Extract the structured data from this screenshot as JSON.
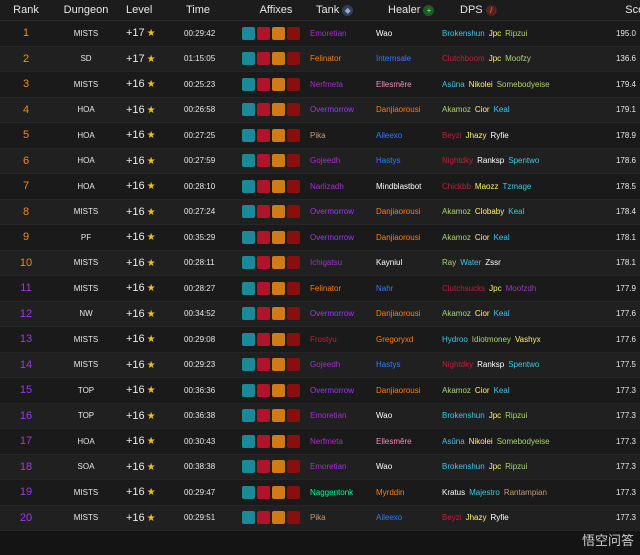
{
  "colors": {
    "orange": "#f08a24",
    "purple": "#a335ee",
    "blue": "#3f74d8",
    "white": "#e8e8e8",
    "dh": "#a330c9",
    "dk": "#c41e3a",
    "druid": "#ff7c0a",
    "hunter": "#aad372",
    "mage": "#3fc7eb",
    "monk": "#00ff98",
    "paladin": "#f48cba",
    "priest": "#ffffff",
    "rogue": "#fff468",
    "shaman": "#2f7dff",
    "warlock": "#8788ee",
    "warrior": "#c69b6d"
  },
  "headers": {
    "rank": "Rank",
    "dungeon": "Dungeon",
    "level": "Level",
    "time": "Time",
    "affixes": "Affixes",
    "tank": "Tank",
    "healer": "Healer",
    "dps": "DPS",
    "score": "Score"
  },
  "icons": {
    "star": "star-icon",
    "tank": "shield-icon",
    "healer": "plus-icon",
    "dps": "sword-icon",
    "faction": "faction-icon",
    "affixes": [
      "tyrannical-icon",
      "bursting-icon",
      "volcanic-icon",
      "reaping-icon"
    ]
  },
  "watermark": "悟空问答",
  "rows": [
    {
      "rank": "1",
      "rank_color": "#f08a24",
      "dungeon": "MISTS",
      "level": "+17",
      "time": "00:29:42",
      "tank": {
        "name": "Emoretian",
        "color": "#a330c9"
      },
      "healer": {
        "name": "Wao",
        "color": "#ffffff"
      },
      "dps": [
        {
          "name": "Brokenshun",
          "color": "#3fc7eb"
        },
        {
          "name": "Jpc",
          "color": "#fff468"
        },
        {
          "name": "Ripzui",
          "color": "#aad372"
        }
      ],
      "score": "195.0",
      "faction": "horde"
    },
    {
      "rank": "2",
      "rank_color": "#f08a24",
      "dungeon": "SD",
      "level": "+17",
      "time": "01:15:05",
      "tank": {
        "name": "Felinator",
        "color": "#ff7c0a"
      },
      "healer": {
        "name": "Internsale",
        "color": "#2f7dff"
      },
      "dps": [
        {
          "name": "Clutchboom",
          "color": "#c41e3a"
        },
        {
          "name": "Jpc",
          "color": "#fff468"
        },
        {
          "name": "Moofzy",
          "color": "#aad372"
        }
      ],
      "score": "136.6",
      "faction": "horde"
    },
    {
      "rank": "3",
      "rank_color": "#f08a24",
      "dungeon": "MISTS",
      "level": "+16",
      "time": "00:25:23",
      "tank": {
        "name": "Nerfmeta",
        "color": "#a330c9"
      },
      "healer": {
        "name": "Ellesmêre",
        "color": "#f48cba"
      },
      "dps": [
        {
          "name": "Asûna",
          "color": "#3fc7eb"
        },
        {
          "name": "Nikolei",
          "color": "#fff468"
        },
        {
          "name": "Somebodyeise",
          "color": "#aad372"
        }
      ],
      "score": "179.4",
      "faction": "horde"
    },
    {
      "rank": "4",
      "rank_color": "#f08a24",
      "dungeon": "HOA",
      "level": "+16",
      "time": "00:26:58",
      "tank": {
        "name": "Overmorrow",
        "color": "#a335ee"
      },
      "healer": {
        "name": "Danjiaorousi",
        "color": "#ff7c0a"
      },
      "dps": [
        {
          "name": "Akamoz",
          "color": "#aad372"
        },
        {
          "name": "Cior",
          "color": "#fff468"
        },
        {
          "name": "Keal",
          "color": "#3fc7eb"
        }
      ],
      "score": "179.1",
      "faction": "horde"
    },
    {
      "rank": "5",
      "rank_color": "#f08a24",
      "dungeon": "HOA",
      "level": "+16",
      "time": "00:27:25",
      "tank": {
        "name": "Pika",
        "color": "#c69b6d"
      },
      "healer": {
        "name": "Aileexo",
        "color": "#2f7dff"
      },
      "dps": [
        {
          "name": "Beyzi",
          "color": "#c41e3a"
        },
        {
          "name": "Jhazy",
          "color": "#fff468"
        },
        {
          "name": "Ryfie",
          "color": "#ffffff"
        }
      ],
      "score": "178.9",
      "faction": "horde"
    },
    {
      "rank": "6",
      "rank_color": "#f08a24",
      "dungeon": "HOA",
      "level": "+16",
      "time": "00:27:59",
      "tank": {
        "name": "Gojeedh",
        "color": "#a330c9"
      },
      "healer": {
        "name": "Hastys",
        "color": "#2f7dff"
      },
      "dps": [
        {
          "name": "Nightdky",
          "color": "#c41e3a"
        },
        {
          "name": "Ranksp",
          "color": "#ffffff"
        },
        {
          "name": "Spentwo",
          "color": "#3fc7eb"
        }
      ],
      "score": "178.6",
      "faction": "horde"
    },
    {
      "rank": "7",
      "rank_color": "#f08a24",
      "dungeon": "HOA",
      "level": "+16",
      "time": "00:28:10",
      "tank": {
        "name": "Narlizadh",
        "color": "#a330c9"
      },
      "healer": {
        "name": "Mindblastbot",
        "color": "#ffffff"
      },
      "dps": [
        {
          "name": "Chickbb",
          "color": "#c41e3a"
        },
        {
          "name": "Maozz",
          "color": "#fff468"
        },
        {
          "name": "Tzmage",
          "color": "#3fc7eb"
        }
      ],
      "score": "178.5",
      "faction": "horde"
    },
    {
      "rank": "8",
      "rank_color": "#f08a24",
      "dungeon": "MISTS",
      "level": "+16",
      "time": "00:27:24",
      "tank": {
        "name": "Overmorrow",
        "color": "#a335ee"
      },
      "healer": {
        "name": "Danjiaorousi",
        "color": "#ff7c0a"
      },
      "dps": [
        {
          "name": "Akamoz",
          "color": "#aad372"
        },
        {
          "name": "Clobaby",
          "color": "#fff468"
        },
        {
          "name": "Keal",
          "color": "#3fc7eb"
        }
      ],
      "score": "178.4",
      "faction": "horde"
    },
    {
      "rank": "9",
      "rank_color": "#f08a24",
      "dungeon": "PF",
      "level": "+16",
      "time": "00:35:29",
      "tank": {
        "name": "Overmorrow",
        "color": "#a335ee"
      },
      "healer": {
        "name": "Danjiaorousi",
        "color": "#ff7c0a"
      },
      "dps": [
        {
          "name": "Akamoz",
          "color": "#aad372"
        },
        {
          "name": "Cior",
          "color": "#fff468"
        },
        {
          "name": "Keal",
          "color": "#3fc7eb"
        }
      ],
      "score": "178.1",
      "faction": "horde"
    },
    {
      "rank": "10",
      "rank_color": "#f08a24",
      "dungeon": "MISTS",
      "level": "+16",
      "time": "00:28:11",
      "tank": {
        "name": "Ichigatsu",
        "color": "#a330c9"
      },
      "healer": {
        "name": "Kayniul",
        "color": "#ffffff"
      },
      "dps": [
        {
          "name": "Ray",
          "color": "#aad372"
        },
        {
          "name": "Water",
          "color": "#3fc7eb"
        },
        {
          "name": "Zssr",
          "color": "#ffffff"
        }
      ],
      "score": "178.1",
      "faction": "horde"
    },
    {
      "rank": "11",
      "rank_color": "#a335ee",
      "dungeon": "MISTS",
      "level": "+16",
      "time": "00:28:27",
      "tank": {
        "name": "Felinator",
        "color": "#ff7c0a"
      },
      "healer": {
        "name": "Nahr",
        "color": "#2f7dff"
      },
      "dps": [
        {
          "name": "Clutchsucks",
          "color": "#c41e3a"
        },
        {
          "name": "Jpc",
          "color": "#fff468"
        },
        {
          "name": "Moofzdh",
          "color": "#a330c9"
        }
      ],
      "score": "177.9",
      "faction": "horde"
    },
    {
      "rank": "12",
      "rank_color": "#a335ee",
      "dungeon": "NW",
      "level": "+16",
      "time": "00:34:52",
      "tank": {
        "name": "Overmorrow",
        "color": "#a335ee"
      },
      "healer": {
        "name": "Danjiaorousi",
        "color": "#ff7c0a"
      },
      "dps": [
        {
          "name": "Akamoz",
          "color": "#aad372"
        },
        {
          "name": "Cior",
          "color": "#fff468"
        },
        {
          "name": "Keal",
          "color": "#3fc7eb"
        }
      ],
      "score": "177.6",
      "faction": "horde"
    },
    {
      "rank": "13",
      "rank_color": "#a335ee",
      "dungeon": "MISTS",
      "level": "+16",
      "time": "00:29:08",
      "tank": {
        "name": "Frostyu",
        "color": "#c41e3a"
      },
      "healer": {
        "name": "Gregoryxd",
        "color": "#ff7c0a"
      },
      "dps": [
        {
          "name": "Hydroo",
          "color": "#3fc7eb"
        },
        {
          "name": "Idiotmoney",
          "color": "#aad372"
        },
        {
          "name": "Vashyx",
          "color": "#fff468"
        }
      ],
      "score": "177.6",
      "faction": "horde"
    },
    {
      "rank": "14",
      "rank_color": "#a335ee",
      "dungeon": "MISTS",
      "level": "+16",
      "time": "00:29:23",
      "tank": {
        "name": "Gojeedh",
        "color": "#a330c9"
      },
      "healer": {
        "name": "Hastys",
        "color": "#2f7dff"
      },
      "dps": [
        {
          "name": "Nightdky",
          "color": "#c41e3a"
        },
        {
          "name": "Ranksp",
          "color": "#ffffff"
        },
        {
          "name": "Spentwo",
          "color": "#3fc7eb"
        }
      ],
      "score": "177.5",
      "faction": "horde"
    },
    {
      "rank": "15",
      "rank_color": "#a335ee",
      "dungeon": "TOP",
      "level": "+16",
      "time": "00:36:36",
      "tank": {
        "name": "Overmorrow",
        "color": "#a335ee"
      },
      "healer": {
        "name": "Danjiaorousi",
        "color": "#ff7c0a"
      },
      "dps": [
        {
          "name": "Akamoz",
          "color": "#aad372"
        },
        {
          "name": "Cior",
          "color": "#fff468"
        },
        {
          "name": "Keal",
          "color": "#3fc7eb"
        }
      ],
      "score": "177.3",
      "faction": "horde"
    },
    {
      "rank": "16",
      "rank_color": "#a335ee",
      "dungeon": "TOP",
      "level": "+16",
      "time": "00:36:38",
      "tank": {
        "name": "Emoretian",
        "color": "#a330c9"
      },
      "healer": {
        "name": "Wao",
        "color": "#ffffff"
      },
      "dps": [
        {
          "name": "Brokenshun",
          "color": "#3fc7eb"
        },
        {
          "name": "Jpc",
          "color": "#fff468"
        },
        {
          "name": "Ripzui",
          "color": "#aad372"
        }
      ],
      "score": "177.3",
      "faction": "horde"
    },
    {
      "rank": "17",
      "rank_color": "#a335ee",
      "dungeon": "HOA",
      "level": "+16",
      "time": "00:30:43",
      "tank": {
        "name": "Nerfmeta",
        "color": "#a330c9"
      },
      "healer": {
        "name": "Ellesmêre",
        "color": "#f48cba"
      },
      "dps": [
        {
          "name": "Asûna",
          "color": "#3fc7eb"
        },
        {
          "name": "Nikolei",
          "color": "#fff468"
        },
        {
          "name": "Somebodyeise",
          "color": "#aad372"
        }
      ],
      "score": "177.3",
      "faction": "horde"
    },
    {
      "rank": "18",
      "rank_color": "#a335ee",
      "dungeon": "SOA",
      "level": "+16",
      "time": "00:38:38",
      "tank": {
        "name": "Emoretian",
        "color": "#a330c9"
      },
      "healer": {
        "name": "Wao",
        "color": "#ffffff"
      },
      "dps": [
        {
          "name": "Brokenshun",
          "color": "#3fc7eb"
        },
        {
          "name": "Jpc",
          "color": "#fff468"
        },
        {
          "name": "Ripzui",
          "color": "#aad372"
        }
      ],
      "score": "177.3",
      "faction": "horde"
    },
    {
      "rank": "19",
      "rank_color": "#a335ee",
      "dungeon": "MISTS",
      "level": "+16",
      "time": "00:29:47",
      "tank": {
        "name": "Naggentonk",
        "color": "#00ff98"
      },
      "healer": {
        "name": "Myrddin",
        "color": "#ff7c0a"
      },
      "dps": [
        {
          "name": "Kratus",
          "color": "#ffffff"
        },
        {
          "name": "Majestro",
          "color": "#3fc7eb"
        },
        {
          "name": "Rantampian",
          "color": "#c69b6d"
        }
      ],
      "score": "177.3",
      "faction": "alliance"
    },
    {
      "rank": "20",
      "rank_color": "#a335ee",
      "dungeon": "MISTS",
      "level": "+16",
      "time": "00:29:51",
      "tank": {
        "name": "Pika",
        "color": "#c69b6d"
      },
      "healer": {
        "name": "Aileexo",
        "color": "#2f7dff"
      },
      "dps": [
        {
          "name": "Beyzi",
          "color": "#c41e3a"
        },
        {
          "name": "Jhazy",
          "color": "#fff468"
        },
        {
          "name": "Ryfie",
          "color": "#ffffff"
        }
      ],
      "score": "177.3",
      "faction": "horde"
    }
  ]
}
